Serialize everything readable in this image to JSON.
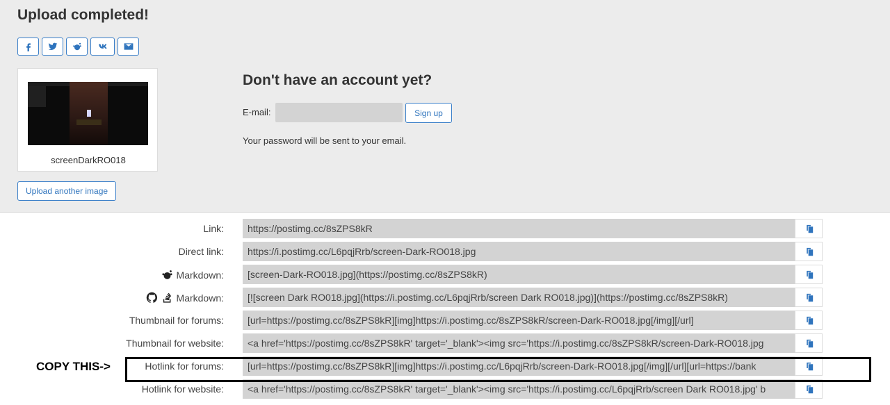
{
  "header": {
    "title": "Upload completed!"
  },
  "share": [
    {
      "name": "facebook-icon"
    },
    {
      "name": "twitter-icon"
    },
    {
      "name": "reddit-icon"
    },
    {
      "name": "vk-icon"
    },
    {
      "name": "email-icon"
    }
  ],
  "thumbnail": {
    "name": "screenDarkRO018"
  },
  "upload_another_label": "Upload another image",
  "account": {
    "title": "Don't have an account yet?",
    "email_label": "E-mail:",
    "email_value": "",
    "signup_label": "Sign up",
    "password_note": "Your password will be sent to your email."
  },
  "links": [
    {
      "label": "Link:",
      "value": "https://postimg.cc/8sZPS8kR",
      "icons": []
    },
    {
      "label": "Direct link:",
      "value": "https://i.postimg.cc/L6pqjRrb/screen-Dark-RO018.jpg",
      "icons": []
    },
    {
      "label": "Markdown:",
      "value": "[screen-Dark-RO018.jpg](https://postimg.cc/8sZPS8kR)",
      "icons": [
        "reddit-icon"
      ]
    },
    {
      "label": "Markdown:",
      "value": "[![screen Dark RO018.jpg](https://i.postimg.cc/L6pqjRrb/screen Dark RO018.jpg)](https://postimg.cc/8sZPS8kR)",
      "icons": [
        "github-icon",
        "stackoverflow-icon"
      ]
    },
    {
      "label": "Thumbnail for forums:",
      "value": "[url=https://postimg.cc/8sZPS8kR][img]https://i.postimg.cc/8sZPS8kR/screen-Dark-RO018.jpg[/img][/url]",
      "icons": []
    },
    {
      "label": "Thumbnail for website:",
      "value": "<a href='https://postimg.cc/8sZPS8kR' target='_blank'><img src='https://i.postimg.cc/8sZPS8kR/screen-Dark-RO018.jpg",
      "icons": []
    },
    {
      "label": "Hotlink for forums:",
      "value": "[url=https://postimg.cc/8sZPS8kR][img]https://i.postimg.cc/L6pqjRrb/screen-Dark-RO018.jpg[/img][/url][url=https://bank",
      "icons": []
    },
    {
      "label": "Hotlink for website:",
      "value": "<a href='https://postimg.cc/8sZPS8kR' target='_blank'><img src='https://i.postimg.cc/L6pqjRrb/screen Dark RO018.jpg' b",
      "icons": []
    }
  ],
  "annotation": {
    "copy_note": "COPY THIS->"
  },
  "colors": {
    "accent": "#2f74bd",
    "field_bg": "#d3d3d3",
    "top_bg": "#ececec"
  }
}
